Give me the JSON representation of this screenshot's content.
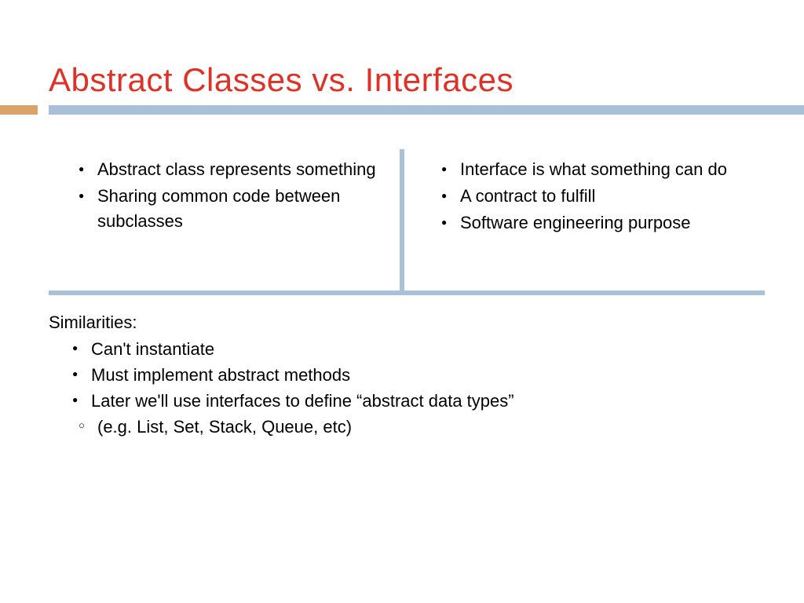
{
  "title": "Abstract Classes vs. Interfaces",
  "left": {
    "items": [
      "Abstract class represents something",
      "Sharing common code between subclasses"
    ]
  },
  "right": {
    "items": [
      "Interface is what something can do",
      "A contract to fulfill",
      "Software engineering purpose"
    ]
  },
  "similarities": {
    "heading": "Similarities:",
    "items": [
      "Can't instantiate",
      "Must implement abstract methods",
      "Later we'll use interfaces to define “abstract data types”"
    ],
    "sub": "(e.g. List, Set, Stack, Queue, etc)"
  }
}
